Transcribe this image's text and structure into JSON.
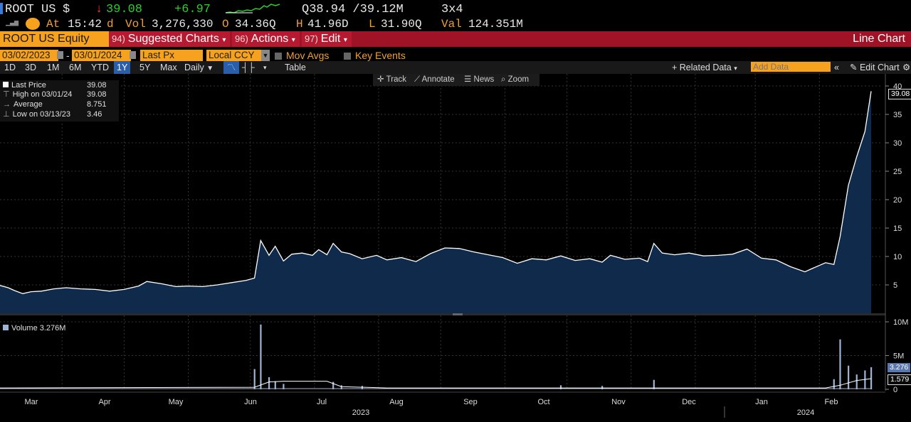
{
  "header": {
    "ticker": "ROOT US",
    "currency_symbol": "$",
    "down_arrow": "↓",
    "last_price": "39.08",
    "change": "+6.97",
    "quote": "Q38.94 /39.12M",
    "size": "3x4",
    "at_label": "At",
    "time": "15:42",
    "time_suffix": "d",
    "vol_label": "Vol",
    "volume": "3,276,330",
    "open_label": "O",
    "open": "34.36Q",
    "high_label": "H",
    "high": "41.96D",
    "low_label": "L",
    "low": "31.90Q",
    "val_label": "Val",
    "val": "124.351M"
  },
  "menubar": {
    "security": "ROOT US Equity",
    "tab1_num": "94)",
    "tab1": "Suggested Charts",
    "tab2_num": "96)",
    "tab2": "Actions",
    "tab3_num": "97)",
    "tab3": "Edit",
    "right_title": "Line Chart"
  },
  "settings": {
    "start_date": "03/02/2023",
    "end_date": "03/01/2024",
    "date_sep": "-",
    "field": "Last Px",
    "currency": "Local CCY",
    "mov_avgs": "Mov Avgs",
    "key_events": "Key Events"
  },
  "periods": [
    "1D",
    "3D",
    "1M",
    "6M",
    "YTD",
    "1Y",
    "5Y",
    "Max"
  ],
  "selected_period": "1Y",
  "toolbar": {
    "frequency": "Daily",
    "table": "Table",
    "related_data": "+ Related Data",
    "add_data_placeholder": "Add Data",
    "edit_chart": "Edit Chart"
  },
  "chart_tools": [
    "Track",
    "Annotate",
    "News",
    "Zoom"
  ],
  "legend": {
    "last_price_label": "Last Price",
    "last_price": "39.08",
    "high_label": "High on 03/01/24",
    "high": "39.08",
    "average_label": "Average",
    "average": "8.751",
    "low_label": "Low on 03/13/23",
    "low": "3.46"
  },
  "volume_legend": "Volume 3.276M",
  "tags": {
    "price": "39.08",
    "volume": "3.276",
    "volume_ma": "1.579"
  },
  "colors": {
    "area_fill": "#0f2a4a",
    "line": "#ffffff",
    "bar": "#9fb3d6",
    "accent": "#f6a21e",
    "menubar": "#a01226"
  },
  "chart_data": [
    {
      "type": "area",
      "series": [
        {
          "name": "Last Price",
          "points": [
            [
              "2023-03-02",
              4.9
            ],
            [
              "2023-03-06",
              4.5
            ],
            [
              "2023-03-09",
              4.0
            ],
            [
              "2023-03-13",
              3.46
            ],
            [
              "2023-03-17",
              3.8
            ],
            [
              "2023-03-22",
              3.9
            ],
            [
              "2023-03-28",
              4.3
            ],
            [
              "2023-04-03",
              4.5
            ],
            [
              "2023-04-10",
              4.3
            ],
            [
              "2023-04-17",
              4.2
            ],
            [
              "2023-04-24",
              3.9
            ],
            [
              "2023-05-01",
              4.2
            ],
            [
              "2023-05-08",
              4.8
            ],
            [
              "2023-05-12",
              5.6
            ],
            [
              "2023-05-19",
              5.2
            ],
            [
              "2023-05-26",
              4.7
            ],
            [
              "2023-06-01",
              4.8
            ],
            [
              "2023-06-08",
              4.7
            ],
            [
              "2023-06-15",
              5.0
            ],
            [
              "2023-06-22",
              5.4
            ],
            [
              "2023-06-29",
              5.8
            ],
            [
              "2023-07-03",
              6.2
            ],
            [
              "2023-07-06",
              12.8
            ],
            [
              "2023-07-10",
              10.2
            ],
            [
              "2023-07-13",
              11.8
            ],
            [
              "2023-07-17",
              9.2
            ],
            [
              "2023-07-21",
              10.4
            ],
            [
              "2023-07-26",
              10.6
            ],
            [
              "2023-07-31",
              10.2
            ],
            [
              "2023-08-03",
              11.2
            ],
            [
              "2023-08-07",
              10.3
            ],
            [
              "2023-08-10",
              12.3
            ],
            [
              "2023-08-14",
              10.8
            ],
            [
              "2023-08-18",
              10.5
            ],
            [
              "2023-08-24",
              9.6
            ],
            [
              "2023-08-31",
              10.2
            ],
            [
              "2023-09-05",
              9.4
            ],
            [
              "2023-09-12",
              9.8
            ],
            [
              "2023-09-19",
              9.1
            ],
            [
              "2023-09-26",
              10.5
            ],
            [
              "2023-10-03",
              11.5
            ],
            [
              "2023-10-10",
              11.4
            ],
            [
              "2023-10-17",
              10.8
            ],
            [
              "2023-10-24",
              10.3
            ],
            [
              "2023-10-31",
              9.8
            ],
            [
              "2023-11-07",
              8.8
            ],
            [
              "2023-11-14",
              9.6
            ],
            [
              "2023-11-21",
              9.4
            ],
            [
              "2023-11-28",
              10.1
            ],
            [
              "2023-12-05",
              9.3
            ],
            [
              "2023-12-12",
              9.6
            ],
            [
              "2023-12-18",
              9.0
            ],
            [
              "2023-12-22",
              10.2
            ],
            [
              "2023-12-29",
              9.5
            ],
            [
              "2024-01-05",
              9.7
            ],
            [
              "2024-01-09",
              9.1
            ],
            [
              "2024-01-12",
              12.3
            ],
            [
              "2024-01-16",
              10.6
            ],
            [
              "2024-01-22",
              10.3
            ],
            [
              "2024-01-29",
              10.6
            ],
            [
              "2024-02-05",
              10.1
            ],
            [
              "2024-02-12",
              10.2
            ],
            [
              "2024-02-19",
              10.4
            ],
            [
              "2024-02-26",
              11.3
            ],
            [
              "2024-03-04",
              9.7
            ],
            [
              "2024-03-11",
              9.4
            ],
            [
              "2024-03-18",
              8.2
            ],
            [
              "2024-03-25",
              7.3
            ],
            [
              "2024-03-28",
              7.8
            ],
            [
              "2024-04-04",
              8.9
            ],
            [
              "2024-04-08",
              8.6
            ],
            [
              "2024-04-11",
              13.5
            ],
            [
              "2024-04-15",
              22.5
            ],
            [
              "2024-04-19",
              27.5
            ],
            [
              "2024-04-23",
              32.0
            ],
            [
              "2024-04-26",
              39.08
            ]
          ]
        }
      ],
      "ylim": [
        0,
        42
      ],
      "y_ticks": [
        5,
        10,
        15,
        20,
        25,
        30,
        35,
        40
      ],
      "grid": true
    },
    {
      "type": "bar",
      "series": [
        {
          "name": "Volume",
          "points": [
            [
              "2023-07-03",
              3.0
            ],
            [
              "2023-07-06",
              9.6
            ],
            [
              "2023-07-10",
              1.8
            ],
            [
              "2023-07-13",
              1.2
            ],
            [
              "2023-07-17",
              0.8
            ],
            [
              "2023-08-10",
              1.1
            ],
            [
              "2023-08-14",
              0.6
            ],
            [
              "2023-08-24",
              0.5
            ],
            [
              "2023-11-28",
              0.6
            ],
            [
              "2023-12-18",
              0.5
            ],
            [
              "2024-01-12",
              1.4
            ],
            [
              "2024-04-08",
              1.5
            ],
            [
              "2024-04-11",
              7.4
            ],
            [
              "2024-04-15",
              3.5
            ],
            [
              "2024-04-19",
              2.2
            ],
            [
              "2024-04-23",
              2.8
            ],
            [
              "2024-04-26",
              3.276
            ]
          ]
        }
      ],
      "ylim": [
        0,
        10
      ],
      "y_ticks_labels": [
        "10M",
        "5M",
        "0"
      ]
    }
  ],
  "x_axis": {
    "months": [
      "Mar",
      "Apr",
      "May",
      "Jun",
      "Jul",
      "Aug",
      "Sep",
      "Oct",
      "Nov",
      "Dec",
      "Jan",
      "Feb"
    ],
    "years": [
      "2023",
      "2024"
    ]
  },
  "price_axis": [
    "40",
    "35",
    "30",
    "25",
    "20",
    "15",
    "10",
    "5"
  ],
  "volume_axis": [
    "10M",
    "5M",
    "0"
  ]
}
